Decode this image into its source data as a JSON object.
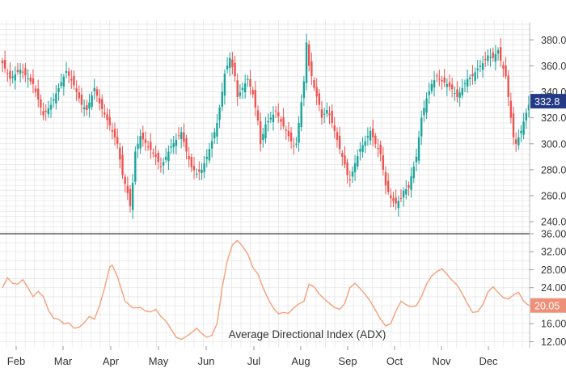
{
  "colors": {
    "up": "#1aa59a",
    "down": "#ef5350",
    "adx": "#f5a07a",
    "grid": "#e3e3e3",
    "axis_text": "#333333",
    "price_badge_bg": "#243a87",
    "adx_badge_bg": "#f08f78",
    "badge_text": "#ffffff",
    "divider": "#444444"
  },
  "chart_data": [
    {
      "type": "candlestick",
      "title": "",
      "x_months": [
        "Feb",
        "Mar",
        "Apr",
        "May",
        "Jun",
        "Jul",
        "Aug",
        "Sep",
        "Oct",
        "Nov",
        "Dec"
      ],
      "ylim": [
        232,
        392
      ],
      "y_ticks": [
        240,
        260,
        280,
        300,
        320,
        340,
        360,
        380
      ],
      "y_tick_labels": [
        "240.0",
        "260.0",
        "280.0",
        "300.0",
        "320.0",
        "340.0",
        "360.0",
        "380.0"
      ],
      "grid": true,
      "last_value_label": "332.8",
      "last_value": 332.8,
      "close_path": [
        [
          0,
          362
        ],
        [
          3,
          350
        ],
        [
          7,
          357
        ],
        [
          12,
          346
        ],
        [
          16,
          322
        ],
        [
          19,
          330
        ],
        [
          22,
          343
        ],
        [
          25,
          356
        ],
        [
          28,
          345
        ],
        [
          31,
          330
        ],
        [
          33,
          326
        ],
        [
          36,
          343
        ],
        [
          38,
          331
        ],
        [
          42,
          314
        ],
        [
          45,
          300
        ],
        [
          47,
          276
        ],
        [
          49,
          262
        ],
        [
          50,
          252
        ],
        [
          51,
          270
        ],
        [
          52,
          294
        ],
        [
          54,
          306
        ],
        [
          57,
          298
        ],
        [
          60,
          290
        ],
        [
          62,
          282
        ],
        [
          64,
          290
        ],
        [
          66,
          298
        ],
        [
          68,
          303
        ],
        [
          70,
          309
        ],
        [
          72,
          294
        ],
        [
          74,
          282
        ],
        [
          76,
          277
        ],
        [
          78,
          280
        ],
        [
          80,
          290
        ],
        [
          82,
          302
        ],
        [
          84,
          316
        ],
        [
          86,
          340
        ],
        [
          87,
          354
        ],
        [
          89,
          366
        ],
        [
          91,
          352
        ],
        [
          92,
          336
        ],
        [
          94,
          343
        ],
        [
          96,
          350
        ],
        [
          98,
          338
        ],
        [
          100,
          318
        ],
        [
          101,
          300
        ],
        [
          103,
          315
        ],
        [
          105,
          320
        ],
        [
          107,
          325
        ],
        [
          109,
          317
        ],
        [
          111,
          310
        ],
        [
          113,
          302
        ],
        [
          114,
          298
        ],
        [
          115,
          300
        ],
        [
          117,
          332
        ],
        [
          118,
          348
        ],
        [
          119,
          378
        ],
        [
          120,
          360
        ],
        [
          121,
          352
        ],
        [
          122,
          343
        ],
        [
          124,
          330
        ],
        [
          125,
          320
        ],
        [
          127,
          326
        ],
        [
          128,
          322
        ],
        [
          130,
          310
        ],
        [
          132,
          296
        ],
        [
          134,
          284
        ],
        [
          135,
          276
        ],
        [
          136,
          272
        ],
        [
          138,
          285
        ],
        [
          140,
          296
        ],
        [
          142,
          302
        ],
        [
          144,
          310
        ],
        [
          146,
          300
        ],
        [
          148,
          292
        ],
        [
          150,
          268
        ],
        [
          152,
          258
        ],
        [
          154,
          254
        ],
        [
          156,
          258
        ],
        [
          157,
          264
        ],
        [
          159,
          266
        ],
        [
          160,
          275
        ],
        [
          162,
          290
        ],
        [
          164,
          320
        ],
        [
          166,
          335
        ],
        [
          168,
          346
        ],
        [
          170,
          352
        ],
        [
          172,
          348
        ],
        [
          174,
          346
        ],
        [
          176,
          342
        ],
        [
          178,
          336
        ],
        [
          180,
          343
        ],
        [
          182,
          350
        ],
        [
          184,
          352
        ],
        [
          186,
          358
        ],
        [
          188,
          362
        ],
        [
          190,
          368
        ],
        [
          192,
          366
        ],
        [
          194,
          372
        ],
        [
          195,
          364
        ],
        [
          197,
          352
        ],
        [
          198,
          336
        ],
        [
          199,
          320
        ],
        [
          200,
          305
        ],
        [
          201,
          300
        ],
        [
          203,
          310
        ],
        [
          205,
          324
        ],
        [
          206,
          330
        ]
      ]
    },
    {
      "type": "line",
      "title": "",
      "annotation": "Average Directional Index (ADX)",
      "ylim": [
        11,
        36
      ],
      "y_ticks": [
        12,
        16,
        20,
        24,
        28,
        32,
        36
      ],
      "y_tick_labels": [
        "12.00",
        "16.00",
        "20.05",
        "24.00",
        "28.00",
        "32.00",
        "36.00"
      ],
      "grid": true,
      "last_value_label": "20.05",
      "last_value": 20.05,
      "series": [
        {
          "points": [
            [
              0,
              24
            ],
            [
              2,
              26.2
            ],
            [
              4,
              25
            ],
            [
              6,
              24.8
            ],
            [
              8,
              25.8
            ],
            [
              10,
              24
            ],
            [
              12,
              22
            ],
            [
              14,
              23.2
            ],
            [
              16,
              22
            ],
            [
              18,
              19
            ],
            [
              20,
              17.2
            ],
            [
              22,
              17
            ],
            [
              24,
              16
            ],
            [
              26,
              16.2
            ],
            [
              28,
              15
            ],
            [
              30,
              15.2
            ],
            [
              32,
              16.2
            ],
            [
              34,
              17.6
            ],
            [
              36,
              17
            ],
            [
              38,
              20
            ],
            [
              40,
              24
            ],
            [
              42,
              28.6
            ],
            [
              43,
              29
            ],
            [
              45,
              26.5
            ],
            [
              48,
              21
            ],
            [
              51,
              19.5
            ],
            [
              54,
              19.6
            ],
            [
              56,
              18.8
            ],
            [
              58,
              18.6
            ],
            [
              60,
              19.2
            ],
            [
              62,
              17.6
            ],
            [
              64,
              16.6
            ],
            [
              66,
              14.8
            ],
            [
              68,
              13
            ],
            [
              70,
              12.5
            ],
            [
              72,
              13.2
            ],
            [
              74,
              14
            ],
            [
              76,
              15
            ],
            [
              78,
              13.8
            ],
            [
              80,
              13
            ],
            [
              82,
              13.4
            ],
            [
              84,
              16
            ],
            [
              86,
              24
            ],
            [
              88,
              30
            ],
            [
              90,
              33.5
            ],
            [
              92,
              34.5
            ],
            [
              94,
              33.2
            ],
            [
              96,
              31.5
            ],
            [
              98,
              28.5
            ],
            [
              100,
              27
            ],
            [
              102,
              24
            ],
            [
              104,
              21.5
            ],
            [
              106,
              19.5
            ],
            [
              108,
              18.2
            ],
            [
              110,
              18.5
            ],
            [
              112,
              18.3
            ],
            [
              114,
              19.5
            ],
            [
              116,
              20.4
            ],
            [
              118,
              21
            ],
            [
              120,
              24.8
            ],
            [
              122,
              24.2
            ],
            [
              124,
              22.6
            ],
            [
              126,
              21.5
            ],
            [
              128,
              20.5
            ],
            [
              130,
              19.6
            ],
            [
              132,
              19.2
            ],
            [
              134,
              20.5
            ],
            [
              136,
              24
            ],
            [
              138,
              25
            ],
            [
              140,
              23.8
            ],
            [
              142,
              22.5
            ],
            [
              144,
              21
            ],
            [
              146,
              19
            ],
            [
              148,
              17
            ],
            [
              150,
              15.5
            ],
            [
              152,
              16
            ],
            [
              154,
              18.8
            ],
            [
              156,
              21
            ],
            [
              158,
              20.2
            ],
            [
              160,
              19.8
            ],
            [
              162,
              20
            ],
            [
              164,
              22
            ],
            [
              166,
              24.8
            ],
            [
              168,
              26.6
            ],
            [
              170,
              27.6
            ],
            [
              172,
              28.2
            ],
            [
              174,
              27
            ],
            [
              176,
              25.6
            ],
            [
              178,
              24.6
            ],
            [
              180,
              22.6
            ],
            [
              182,
              20.5
            ],
            [
              184,
              18.5
            ],
            [
              186,
              18.7
            ],
            [
              188,
              20.2
            ],
            [
              190,
              23
            ],
            [
              192,
              24.2
            ],
            [
              194,
              23
            ],
            [
              196,
              21.8
            ],
            [
              198,
              21.5
            ],
            [
              200,
              22.4
            ],
            [
              202,
              23
            ],
            [
              204,
              21
            ],
            [
              206,
              20.05
            ]
          ]
        }
      ]
    }
  ]
}
